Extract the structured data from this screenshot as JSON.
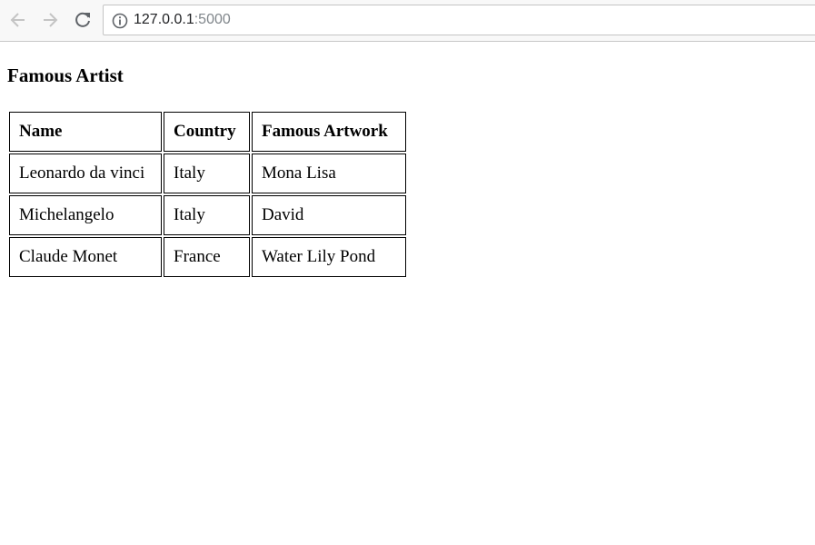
{
  "browser": {
    "back_icon": "arrow-left-icon",
    "forward_icon": "arrow-right-icon",
    "reload_icon": "reload-icon",
    "info_icon": "info-icon",
    "url_host": "127.0.0.1",
    "url_port": ":5000"
  },
  "page": {
    "title": "Famous Artist",
    "table": {
      "headers": [
        "Name",
        "Country",
        "Famous Artwork"
      ],
      "rows": [
        [
          "Leonardo da vinci",
          "Italy",
          "Mona Lisa"
        ],
        [
          "Michelangelo",
          "Italy",
          "David"
        ],
        [
          "Claude Monet",
          "France",
          "Water Lily Pond"
        ]
      ]
    }
  }
}
